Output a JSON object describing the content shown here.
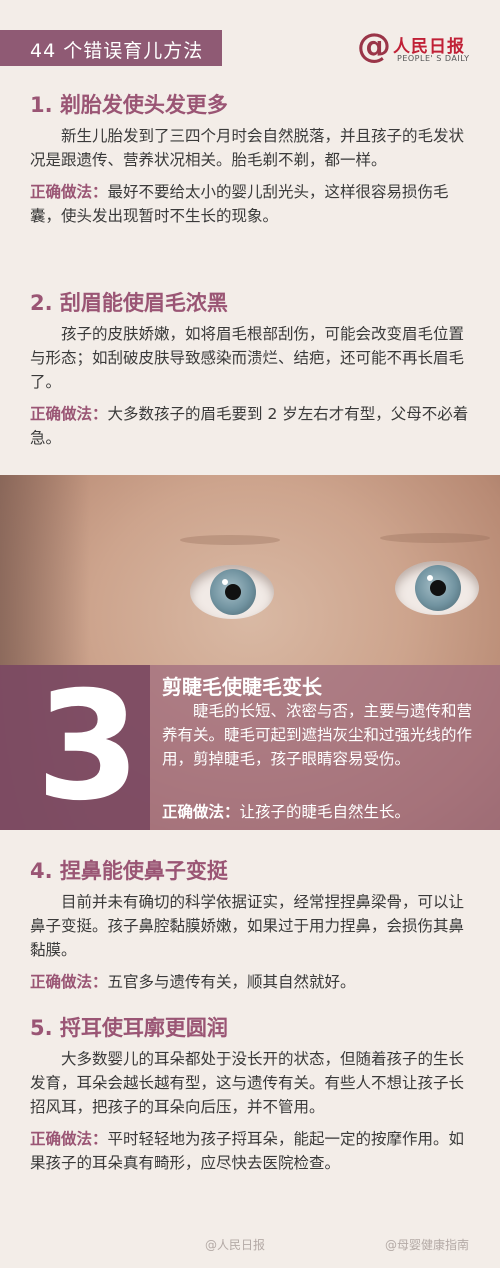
{
  "header": {
    "title": "44 个错误育儿方法"
  },
  "logo": {
    "at": "@",
    "cn": "人民日报",
    "en": "PEOPLE' S DAILY"
  },
  "sections": [
    {
      "title": "1. 剃胎发使头发更多",
      "body": "新生儿胎发到了三四个月时会自然脱落，并且孩子的毛发状况是跟遗传、营养状况相关。胎毛剃不剃，都一样。",
      "tip_label": "正确做法：",
      "tip": "最好不要给太小的婴儿刮光头，这样很容易损伤毛囊，使头发出现暂时不生长的现象。"
    },
    {
      "title": "2. 刮眉能使眉毛浓黑",
      "body": "孩子的皮肤娇嫩，如将眉毛根部刮伤，可能会改变眉毛位置与形态；如刮破皮肤导致感染而溃烂、结疤，还可能不再长眉毛了。",
      "tip_label": "正确做法：",
      "tip": "大多数孩子的眉毛要到 2 岁左右才有型，父母不必着急。"
    },
    {
      "number": "3",
      "title": "剪睫毛使睫毛变长",
      "body": "睫毛的长短、浓密与否，主要与遗传和营养有关。睫毛可起到遮挡灰尘和过强光线的作用，剪掉睫毛，孩子眼睛容易受伤。",
      "tip_label": "正确做法：",
      "tip": "让孩子的睫毛自然生长。"
    },
    {
      "title": "4. 捏鼻能使鼻子变挺",
      "body": "目前并未有确切的科学依据证实，经常捏捏鼻梁骨，可以让鼻子变挺。孩子鼻腔黏膜娇嫩，如果过于用力捏鼻，会损伤其鼻黏膜。",
      "tip_label": "正确做法：",
      "tip": "五官多与遗传有关，顺其自然就好。"
    },
    {
      "title": "5. 捋耳使耳廓更圆润",
      "body": "大多数婴儿的耳朵都处于没长开的状态，但随着孩子的生长发育，耳朵会越长越有型，这与遗传有关。有些人不想让孩子长招风耳，把孩子的耳朵向后压，并不管用。",
      "tip_label": "正确做法：",
      "tip": "平时轻轻地为孩子捋耳朵，能起一定的按摩作用。如果孩子的耳朵真有畸形，应尽快去医院检查。"
    }
  ],
  "footer": {
    "left": "@人民日报",
    "right": "@母婴健康指南"
  }
}
